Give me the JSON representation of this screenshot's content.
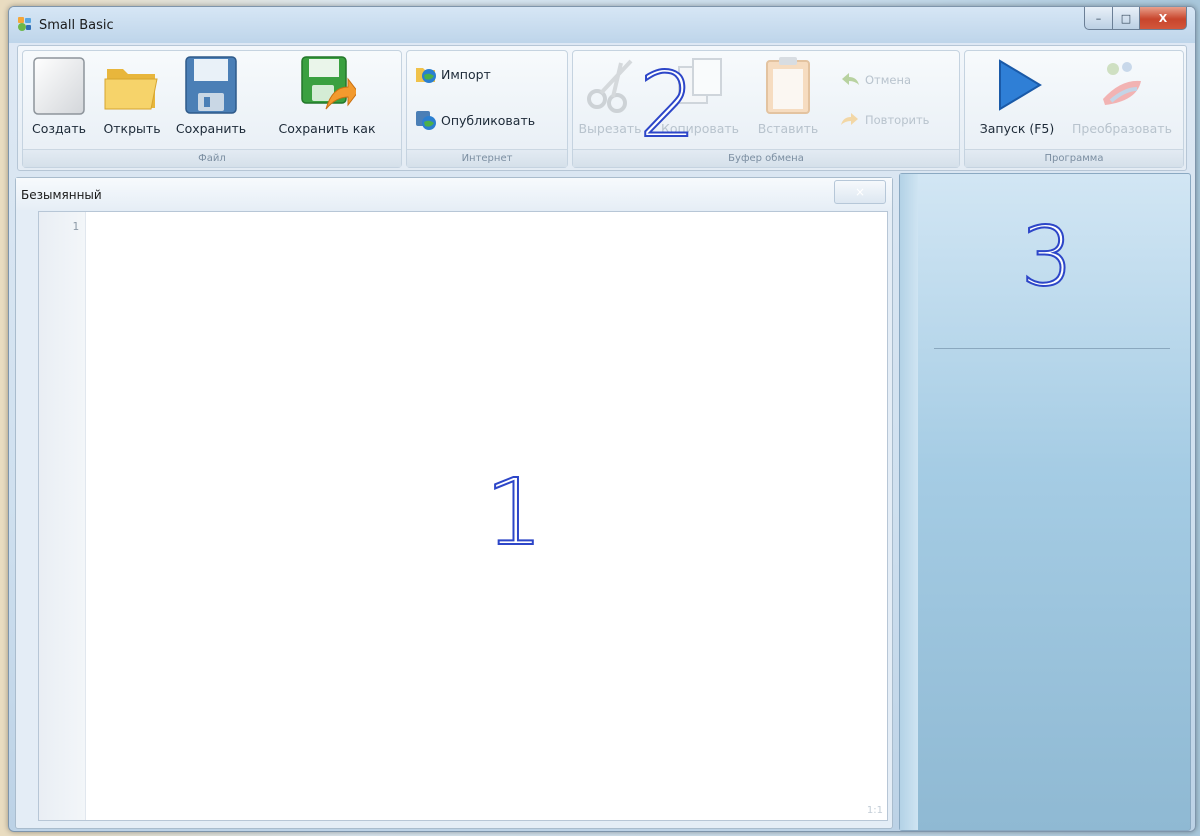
{
  "window": {
    "title": "Small Basic"
  },
  "titlebar_buttons": {
    "minimize": "–",
    "maximize": "□",
    "close": "X"
  },
  "ribbon": {
    "file_group": {
      "caption": "Файл",
      "new_label": "Создать",
      "open_label": "Открыть",
      "save_label": "Сохранить",
      "save_as_label": "Сохранить как"
    },
    "internet_group": {
      "caption": "Интернет",
      "import_label": "Импорт",
      "publish_label": "Опубликовать"
    },
    "clipboard_group": {
      "caption": "Буфер обмена",
      "cut_label": "Вырезать",
      "copy_label": "Копировать",
      "paste_label": "Вставить",
      "undo_label": "Отмена",
      "redo_label": "Повторить"
    },
    "program_group": {
      "caption": "Программа",
      "run_label": "Запуск (F5)",
      "graduate_label": "Преобразовать"
    }
  },
  "editor": {
    "tab_title": "Безымянный",
    "close_glyph": "×",
    "line_numbers": [
      "1"
    ],
    "cursor_position": "1:1"
  },
  "markers": {
    "editor": "1",
    "toolbar": "2",
    "help_panel": "3"
  },
  "colors": {
    "marker_outline": "#2d46c8",
    "run_icon": "#2f7fd6",
    "folder": "#f2c94c",
    "save_disk": "#4b7fb6",
    "save_as_disk": "#3aa040"
  }
}
